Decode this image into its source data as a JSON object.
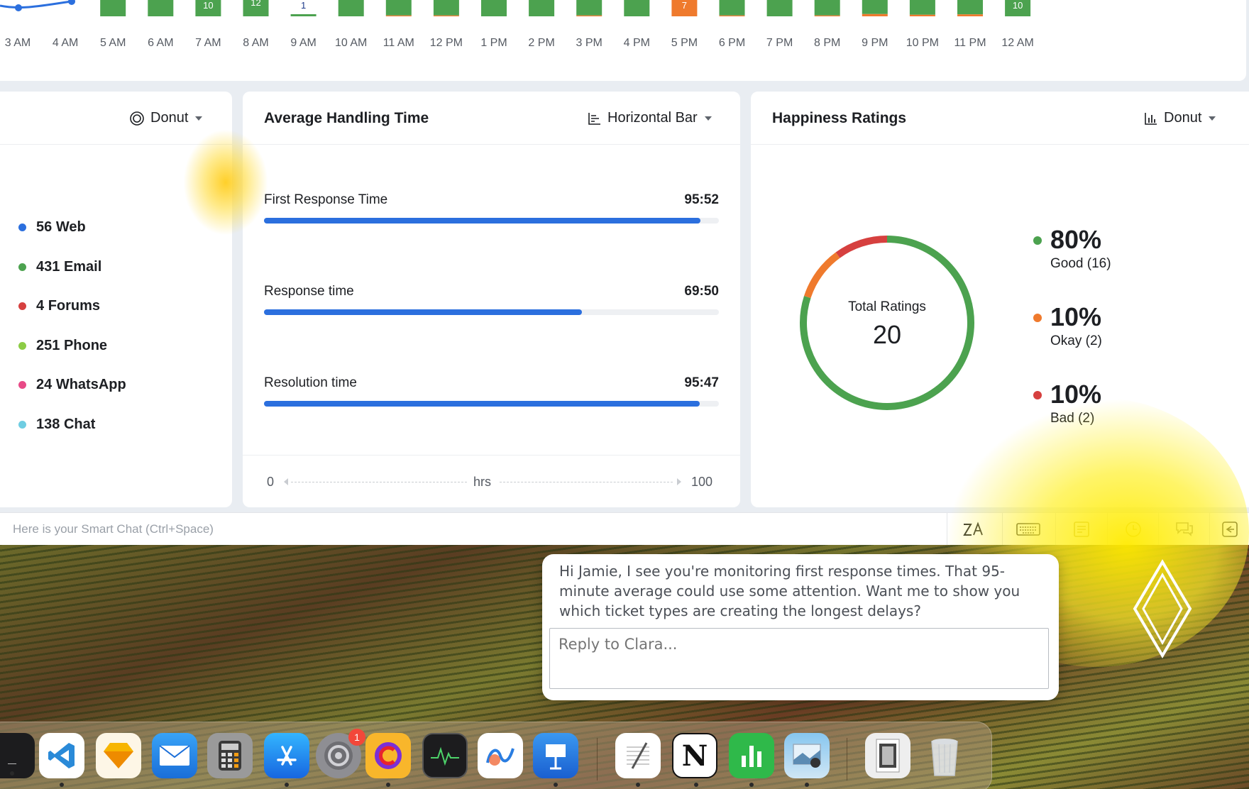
{
  "hourly_chart": {
    "chart_data": {
      "type": "bar",
      "categories": [
        "3 AM",
        "4 AM",
        "5 AM",
        "6 AM",
        "7 AM",
        "8 AM",
        "9 AM",
        "10 AM",
        "11 AM",
        "12 PM",
        "1 PM",
        "2 PM",
        "3 PM",
        "4 PM",
        "5 PM",
        "6 PM",
        "7 PM",
        "8 PM",
        "9 PM",
        "10 PM",
        "11 PM",
        "12 AM"
      ],
      "series": [
        {
          "name": "",
          "color": "#4ca24f",
          "values": [
            null,
            null,
            1,
            1,
            1,
            1,
            0,
            1,
            1,
            1,
            1,
            1,
            1,
            1,
            0,
            1,
            1,
            1,
            1,
            1,
            1,
            1
          ]
        },
        {
          "name": "",
          "color": "#ef7a2d",
          "values": [
            null,
            null,
            0,
            0,
            0,
            0,
            0,
            0,
            0.15,
            0.15,
            0,
            0,
            0.15,
            0,
            1,
            0.15,
            0,
            0.15,
            0.5,
            0.3,
            0.4,
            0
          ]
        }
      ],
      "bar_labels": {
        "7 AM": "10",
        "8 AM": "12",
        "5 PM": "7",
        "12 AM": "10",
        "9 AM": "1"
      }
    }
  },
  "channels_panel": {
    "chart_type": "Donut",
    "items": [
      {
        "count": "56",
        "label": "Web",
        "color": "#2b6fde"
      },
      {
        "count": "431",
        "label": "Email",
        "color": "#4ca24f"
      },
      {
        "count": "4",
        "label": "Forums",
        "color": "#d6403f"
      },
      {
        "count": "251",
        "label": "Phone",
        "color": "#8ccc45"
      },
      {
        "count": "24",
        "label": "WhatsApp",
        "color": "#e84a87"
      },
      {
        "count": "138",
        "label": "Chat",
        "color": "#6fcde2"
      }
    ]
  },
  "aht_panel": {
    "title": "Average Handling Time",
    "chart_type": "Horizontal Bar",
    "chart_data": {
      "type": "bar",
      "orientation": "horizontal",
      "categories": [
        "First Response Time",
        "Response time",
        "Resolution time"
      ],
      "values": [
        95.87,
        69.83,
        95.78
      ],
      "display_values": [
        "95:52",
        "69:50",
        "95:47"
      ],
      "xlim": [
        0,
        100
      ],
      "xlabel": "hrs"
    },
    "axis": {
      "min": "0",
      "max": "100",
      "unit": "hrs"
    }
  },
  "happiness_panel": {
    "title": "Happiness Ratings",
    "chart_type": "Donut",
    "center_label": "Total Ratings",
    "center_value": "20",
    "chart_data": {
      "type": "pie",
      "categories": [
        "Good",
        "Okay",
        "Bad"
      ],
      "values": [
        16,
        2,
        2
      ],
      "colors": [
        "#4ca24f",
        "#ef7a2d",
        "#d6403f"
      ]
    },
    "legend": [
      {
        "pct": "80%",
        "sub": "Good (16)",
        "color": "#4ca24f"
      },
      {
        "pct": "10%",
        "sub": "Okay (2)",
        "color": "#ef7a2d"
      },
      {
        "pct": "10%",
        "sub": "Bad (2)",
        "color": "#d6403f"
      }
    ]
  },
  "smart_chat": {
    "placeholder": "Here is your Smart Chat (Ctrl+Space)",
    "icons": [
      "translate-icon",
      "keyboard-icon",
      "notes-icon",
      "clock-icon",
      "chat-bubbles-icon",
      "reply-icon"
    ]
  },
  "assistant_chat": {
    "message": "Hi Jamie, I see you're monitoring first response times. That 95-minute average could use some attention. Want me to show you which ticket types are creating the longest delays?",
    "reply_placeholder": "Reply to Clara..."
  },
  "dock": {
    "apps": [
      "terminal",
      "vscode",
      "sketch",
      "mail",
      "calculator",
      "app-store",
      "system-settings",
      "cursor-app",
      "activity-monitor",
      "freeform",
      "keynote",
      "textedit",
      "notion",
      "numbers",
      "preview",
      "downloads-folder",
      "trash"
    ],
    "settings_badge": "1"
  }
}
